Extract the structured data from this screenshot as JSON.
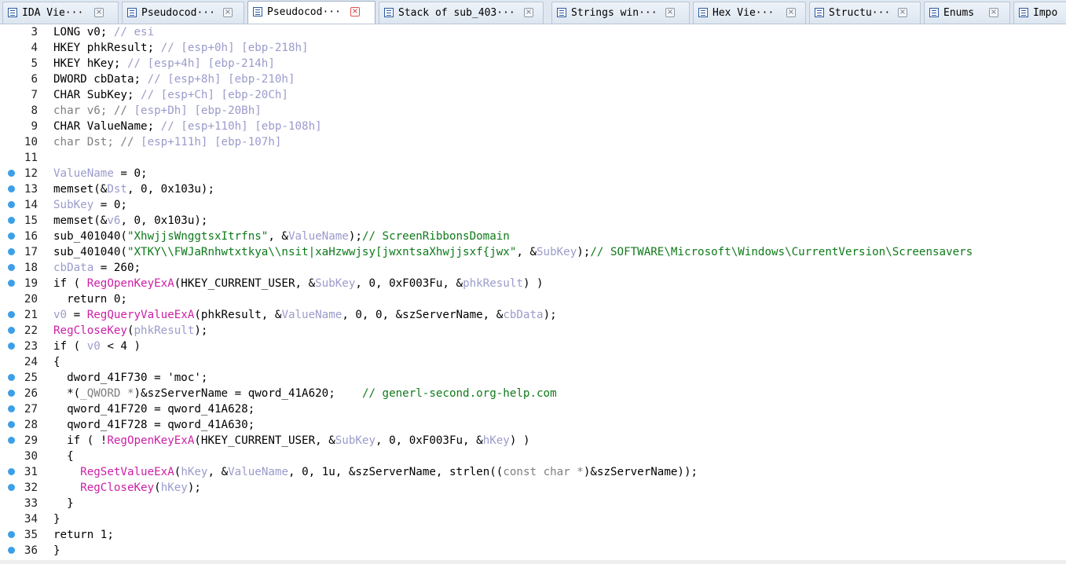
{
  "tabs": [
    {
      "label": "IDA Vie···",
      "icon": "ida-view-icon",
      "active": false
    },
    {
      "label": "Pseudocod···",
      "icon": "pseudocode-icon",
      "active": false
    },
    {
      "label": "Pseudocod···",
      "icon": "pseudocode-icon",
      "active": true
    },
    {
      "label": "Stack of sub_403···",
      "icon": "stack-icon",
      "active": false
    },
    {
      "label": "Strings win···",
      "icon": "strings-icon",
      "active": false
    },
    {
      "label": "Hex Vie···",
      "icon": "hex-view-icon",
      "active": false
    },
    {
      "label": "Structu···",
      "icon": "structures-icon",
      "active": false
    },
    {
      "label": "Enums",
      "icon": "enums-icon",
      "active": false
    },
    {
      "label": "Impo",
      "icon": "imports-icon",
      "active": false
    }
  ],
  "close_glyph": "×",
  "code": [
    {
      "n": "3",
      "bp": false,
      "t": [
        [
          "LONG v0; ",
          "k"
        ],
        [
          "// esi",
          "lv"
        ]
      ]
    },
    {
      "n": "4",
      "bp": false,
      "t": [
        [
          "HKEY phkResult; ",
          "k"
        ],
        [
          "// [esp+0h] [ebp-218h]",
          "lv"
        ]
      ]
    },
    {
      "n": "5",
      "bp": false,
      "t": [
        [
          "HKEY hKey; ",
          "k"
        ],
        [
          "// [esp+4h] [ebp-214h]",
          "lv"
        ]
      ]
    },
    {
      "n": "6",
      "bp": false,
      "t": [
        [
          "DWORD cbData; ",
          "k"
        ],
        [
          "// [esp+8h] [ebp-210h]",
          "lv"
        ]
      ]
    },
    {
      "n": "7",
      "bp": false,
      "t": [
        [
          "CHAR SubKey; ",
          "k"
        ],
        [
          "// [esp+Ch] [ebp-20Ch]",
          "lv"
        ]
      ]
    },
    {
      "n": "8",
      "bp": false,
      "t": [
        [
          "char v6; // ",
          "ty"
        ],
        [
          "[esp+Dh] [ebp-20Bh]",
          "lv"
        ]
      ]
    },
    {
      "n": "9",
      "bp": false,
      "t": [
        [
          "CHAR ValueName; ",
          "k"
        ],
        [
          "// [esp+110h] [ebp-108h]",
          "lv"
        ]
      ]
    },
    {
      "n": "10",
      "bp": false,
      "t": [
        [
          "char Dst; // ",
          "ty"
        ],
        [
          "[esp+111h] [ebp-107h]",
          "lv"
        ]
      ]
    },
    {
      "n": "11",
      "bp": false,
      "t": []
    },
    {
      "n": "12",
      "bp": true,
      "t": [
        [
          "ValueName",
          "lv"
        ],
        [
          " = 0;",
          "k"
        ]
      ]
    },
    {
      "n": "13",
      "bp": true,
      "t": [
        [
          "memset(&",
          "k"
        ],
        [
          "Dst",
          "lv"
        ],
        [
          ", 0, 0x103u);",
          "k"
        ]
      ]
    },
    {
      "n": "14",
      "bp": true,
      "t": [
        [
          "SubKey",
          "lv"
        ],
        [
          " = 0;",
          "k"
        ]
      ]
    },
    {
      "n": "15",
      "bp": true,
      "t": [
        [
          "memset(&",
          "k"
        ],
        [
          "v6",
          "lv"
        ],
        [
          ", 0, 0x103u);",
          "k"
        ]
      ]
    },
    {
      "n": "16",
      "bp": true,
      "t": [
        [
          "sub_401040(",
          "k"
        ],
        [
          "\"XhwjjsWnggtsxItrfns\"",
          "st"
        ],
        [
          ", &",
          "k"
        ],
        [
          "ValueName",
          "lv"
        ],
        [
          ");",
          "k"
        ],
        [
          "// ScreenRibbonsDomain",
          "cm"
        ]
      ]
    },
    {
      "n": "17",
      "bp": true,
      "t": [
        [
          "sub_401040(",
          "k"
        ],
        [
          "\"XTKY\\\\FWJaRnhwtxtkya\\\\nsit|xaHzwwjsy[jwxntsaXhwjjsxf{jwx\"",
          "st"
        ],
        [
          ", &",
          "k"
        ],
        [
          "SubKey",
          "lv"
        ],
        [
          ");",
          "k"
        ],
        [
          "// SOFTWARE\\Microsoft\\Windows\\CurrentVersion\\Screensavers",
          "cm"
        ]
      ]
    },
    {
      "n": "18",
      "bp": true,
      "t": [
        [
          "cbData",
          "lv"
        ],
        [
          " = 260;",
          "k"
        ]
      ]
    },
    {
      "n": "19",
      "bp": true,
      "t": [
        [
          "if ( ",
          "k"
        ],
        [
          "RegOpenKeyExA",
          "fn"
        ],
        [
          "(HKEY_CURRENT_USER, &",
          "k"
        ],
        [
          "SubKey",
          "lv"
        ],
        [
          ", 0, 0xF003Fu, &",
          "k"
        ],
        [
          "phkResult",
          "lv"
        ],
        [
          ") )",
          "k"
        ]
      ]
    },
    {
      "n": "20",
      "bp": false,
      "t": [
        [
          "  return 0;",
          "k"
        ]
      ]
    },
    {
      "n": "21",
      "bp": true,
      "t": [
        [
          "v0",
          "lv"
        ],
        [
          " = ",
          "k"
        ],
        [
          "RegQueryValueExA",
          "fn"
        ],
        [
          "(phkResult, &",
          "k"
        ],
        [
          "ValueName",
          "lv"
        ],
        [
          ", 0, 0, &szServerName, &",
          "k"
        ],
        [
          "cbData",
          "lv"
        ],
        [
          ");",
          "k"
        ]
      ]
    },
    {
      "n": "22",
      "bp": true,
      "t": [
        [
          "RegCloseKey",
          "fn"
        ],
        [
          "(",
          "k"
        ],
        [
          "phkResult",
          "lv"
        ],
        [
          ");",
          "k"
        ]
      ]
    },
    {
      "n": "23",
      "bp": true,
      "t": [
        [
          "if ( ",
          "k"
        ],
        [
          "v0",
          "lv"
        ],
        [
          " < 4 )",
          "k"
        ]
      ]
    },
    {
      "n": "24",
      "bp": false,
      "t": [
        [
          "{",
          "k"
        ]
      ]
    },
    {
      "n": "25",
      "bp": true,
      "t": [
        [
          "  dword_41F730 = 'moc';",
          "k"
        ]
      ]
    },
    {
      "n": "26",
      "bp": true,
      "t": [
        [
          "  *(",
          "k"
        ],
        [
          "_QWORD *",
          "ty"
        ],
        [
          ")&szServerName = qword_41A620;    ",
          "k"
        ],
        [
          "// generl-second.org-help.com",
          "cm"
        ]
      ]
    },
    {
      "n": "27",
      "bp": true,
      "t": [
        [
          "  qword_41F720 = qword_41A628;",
          "k"
        ]
      ]
    },
    {
      "n": "28",
      "bp": true,
      "t": [
        [
          "  qword_41F728 = qword_41A630;",
          "k"
        ]
      ]
    },
    {
      "n": "29",
      "bp": true,
      "t": [
        [
          "  if ( !",
          "k"
        ],
        [
          "RegOpenKeyExA",
          "fn"
        ],
        [
          "(HKEY_CURRENT_USER, &",
          "k"
        ],
        [
          "SubKey",
          "lv"
        ],
        [
          ", 0, 0xF003Fu, &",
          "k"
        ],
        [
          "hKey",
          "lv"
        ],
        [
          ") )",
          "k"
        ]
      ]
    },
    {
      "n": "30",
      "bp": false,
      "t": [
        [
          "  {",
          "k"
        ]
      ]
    },
    {
      "n": "31",
      "bp": true,
      "t": [
        [
          "    ",
          "k"
        ],
        [
          "RegSetValueExA",
          "fn"
        ],
        [
          "(",
          "k"
        ],
        [
          "hKey",
          "lv"
        ],
        [
          ", &",
          "k"
        ],
        [
          "ValueName",
          "lv"
        ],
        [
          ", 0, 1u, &szServerName, strlen((",
          "k"
        ],
        [
          "const char *",
          "ty"
        ],
        [
          ")&szServerName));",
          "k"
        ]
      ]
    },
    {
      "n": "32",
      "bp": true,
      "t": [
        [
          "    ",
          "k"
        ],
        [
          "RegCloseKey",
          "fn"
        ],
        [
          "(",
          "k"
        ],
        [
          "hKey",
          "lv"
        ],
        [
          ");",
          "k"
        ]
      ]
    },
    {
      "n": "33",
      "bp": false,
      "t": [
        [
          "  }",
          "k"
        ]
      ]
    },
    {
      "n": "34",
      "bp": false,
      "t": [
        [
          "}",
          "k"
        ]
      ]
    },
    {
      "n": "35",
      "bp": true,
      "t": [
        [
          "return 1;",
          "k"
        ]
      ]
    },
    {
      "n": "36",
      "bp": true,
      "t": [
        [
          "}",
          "k"
        ]
      ]
    }
  ]
}
